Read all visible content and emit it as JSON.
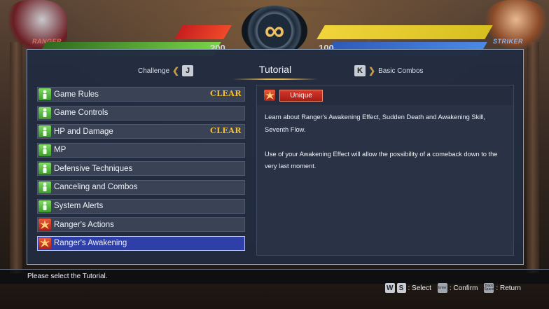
{
  "hud": {
    "p1_name": "RANGER",
    "p2_name": "STRIKER",
    "p1_score": "200",
    "p2_score": "100",
    "timer": "∞",
    "colors": {
      "p1_meter": "#e83a2a",
      "p1_health": "#6fcf3c",
      "p2_meter": "#f0d43a",
      "p2_health": "#3a7ad8"
    }
  },
  "tabs": {
    "left_label": "Challenge",
    "left_key": "J",
    "center_label": "Tutorial",
    "right_key": "K",
    "right_label": "Basic Combos"
  },
  "tutorial_list": [
    {
      "label": "Game Rules",
      "status": "CLEAR",
      "icon": "green-character-icon"
    },
    {
      "label": "Game Controls",
      "status": "",
      "icon": "green-character-icon"
    },
    {
      "label": "HP and Damage",
      "status": "CLEAR",
      "icon": "green-character-icon"
    },
    {
      "label": "MP",
      "status": "",
      "icon": "green-character-icon"
    },
    {
      "label": "Defensive Techniques",
      "status": "",
      "icon": "green-character-icon"
    },
    {
      "label": "Canceling and Combos",
      "status": "",
      "icon": "green-character-icon"
    },
    {
      "label": "System Alerts",
      "status": "",
      "icon": "green-character-icon"
    },
    {
      "label": "Ranger's Actions",
      "status": "",
      "icon": "red-burst-icon"
    },
    {
      "label": "Ranger's Awakening",
      "status": "",
      "icon": "red-burst-icon",
      "selected": true
    }
  ],
  "detail": {
    "badge": "Unique",
    "paragraph1": "Learn about Ranger's Awakening Effect, Sudden Death and Awakening Skill, Seventh Flow.",
    "paragraph2": "Use of your Awakening Effect will allow the possibility of a comeback down to the very last moment."
  },
  "help_text": "Please select the Tutorial.",
  "controls": {
    "key_w": "W",
    "key_s": "S",
    "select_label": ": Select",
    "enter_key": "Enter",
    "confirm_label": ": Confirm",
    "back_key": "Back Space",
    "return_label": ": Return"
  }
}
